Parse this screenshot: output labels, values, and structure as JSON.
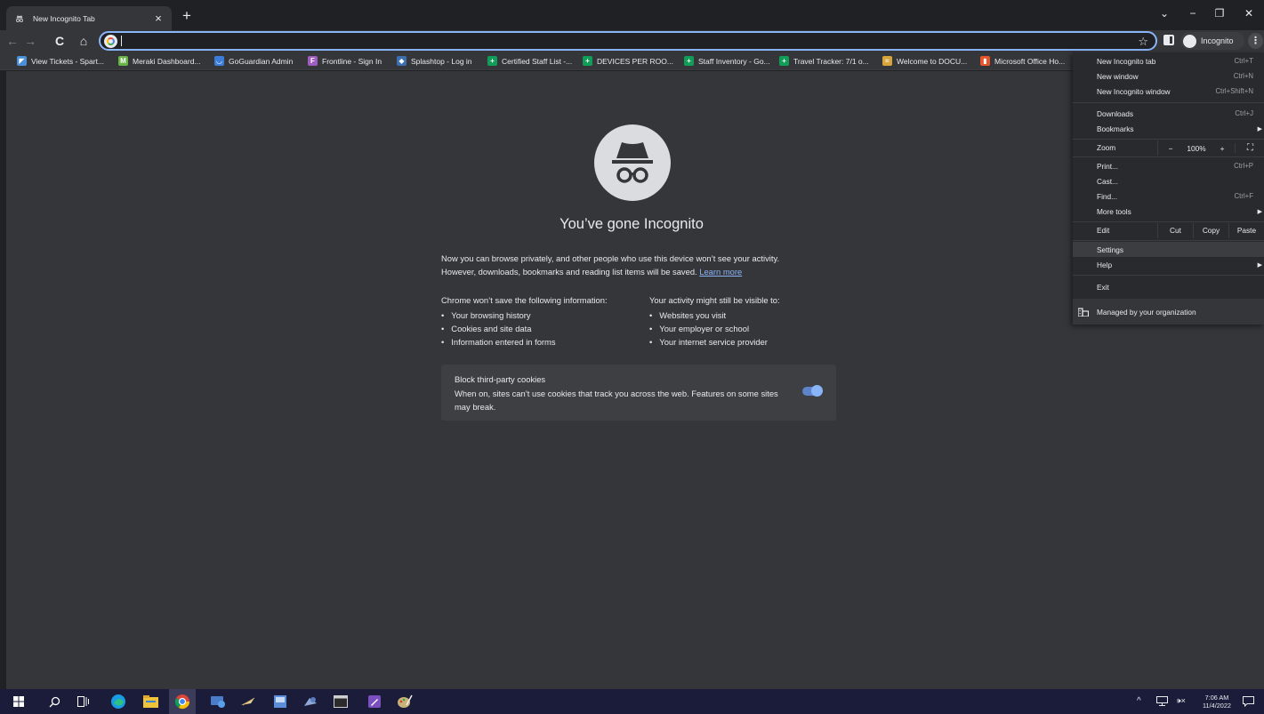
{
  "tab": {
    "title": "New Incognito Tab",
    "close": "×"
  },
  "new_tab": "+",
  "window_controls": {
    "minimize": "−",
    "maximize": "❐",
    "close": "✕",
    "tab_search": "⌄"
  },
  "toolbar": {
    "back": "←",
    "forward": "→",
    "reload": "C",
    "home": "⌂",
    "omnibox_value": "",
    "bookmark_star": "☆",
    "profile_label": "Incognito",
    "menu": "⋮"
  },
  "bookmarks": [
    {
      "label": "View Tickets - Spart...",
      "icon": "spiceworks-icon",
      "color": "#4a90d9",
      "glyph": "◤"
    },
    {
      "label": "Meraki Dashboard...",
      "icon": "meraki-icon",
      "color": "#67b346",
      "glyph": "M"
    },
    {
      "label": "GoGuardian Admin",
      "icon": "goguardian-icon",
      "color": "#3b7dd8",
      "glyph": "◡"
    },
    {
      "label": "Frontline - Sign In",
      "icon": "frontline-icon",
      "color": "#a05cc0",
      "glyph": "F"
    },
    {
      "label": "Splashtop - Log in",
      "icon": "splashtop-icon",
      "color": "#3a6fb0",
      "glyph": "◆"
    },
    {
      "label": "Certified Staff List -...",
      "icon": "sheets-icon",
      "color": "#0f9d58",
      "glyph": "+"
    },
    {
      "label": "DEVICES PER ROO...",
      "icon": "sheets-icon",
      "color": "#0f9d58",
      "glyph": "+"
    },
    {
      "label": "Staff Inventory - Go...",
      "icon": "sheets-icon",
      "color": "#0f9d58",
      "glyph": "+"
    },
    {
      "label": "Travel Tracker: 7/1 o...",
      "icon": "sheets-icon",
      "color": "#0f9d58",
      "glyph": "+"
    },
    {
      "label": "Welcome to DOCU...",
      "icon": "docusign-icon",
      "color": "#d9a53a",
      "glyph": "≈"
    },
    {
      "label": "Microsoft Office Ho...",
      "icon": "office-icon",
      "color": "#e8542c",
      "glyph": "▮"
    }
  ],
  "page": {
    "headline": "You’ve gone Incognito",
    "intro_line1": "Now you can browse privately, and other people who use this device won’t see your activity.",
    "intro_line2": "However, downloads, bookmarks and reading list items will be saved.",
    "learn_more": "Learn more",
    "not_saved_heading": "Chrome won’t save the following information:",
    "not_saved_items": [
      "Your browsing history",
      "Cookies and site data",
      "Information entered in forms"
    ],
    "visible_heading": "Your activity might still be visible to:",
    "visible_items": [
      "Websites you visit",
      "Your employer or school",
      "Your internet service provider"
    ],
    "cookie_title": "Block third-party cookies",
    "cookie_desc": "When on, sites can’t use cookies that track you across the web. Features on some sites may break.",
    "cookie_toggle_on": true
  },
  "menu": {
    "new_incognito_tab": "New Incognito tab",
    "new_incognito_tab_sc": "Ctrl+T",
    "new_window": "New window",
    "new_window_sc": "Ctrl+N",
    "new_incognito_window": "New Incognito window",
    "new_incognito_window_sc": "Ctrl+Shift+N",
    "downloads": "Downloads",
    "downloads_sc": "Ctrl+J",
    "bookmarks": "Bookmarks",
    "zoom": "Zoom",
    "zoom_minus": "−",
    "zoom_value": "100%",
    "zoom_plus": "+",
    "fullscreen": "⛶",
    "print": "Print...",
    "print_sc": "Ctrl+P",
    "cast": "Cast...",
    "find": "Find...",
    "find_sc": "Ctrl+F",
    "more_tools": "More tools",
    "edit": "Edit",
    "cut": "Cut",
    "copy": "Copy",
    "paste": "Paste",
    "settings": "Settings",
    "help": "Help",
    "exit": "Exit",
    "managed": "Managed by your organization"
  },
  "taskbar": {
    "time": "7:06 AM",
    "date": "11/4/2022",
    "tray_chevron": "^",
    "volume": "🕩×"
  }
}
